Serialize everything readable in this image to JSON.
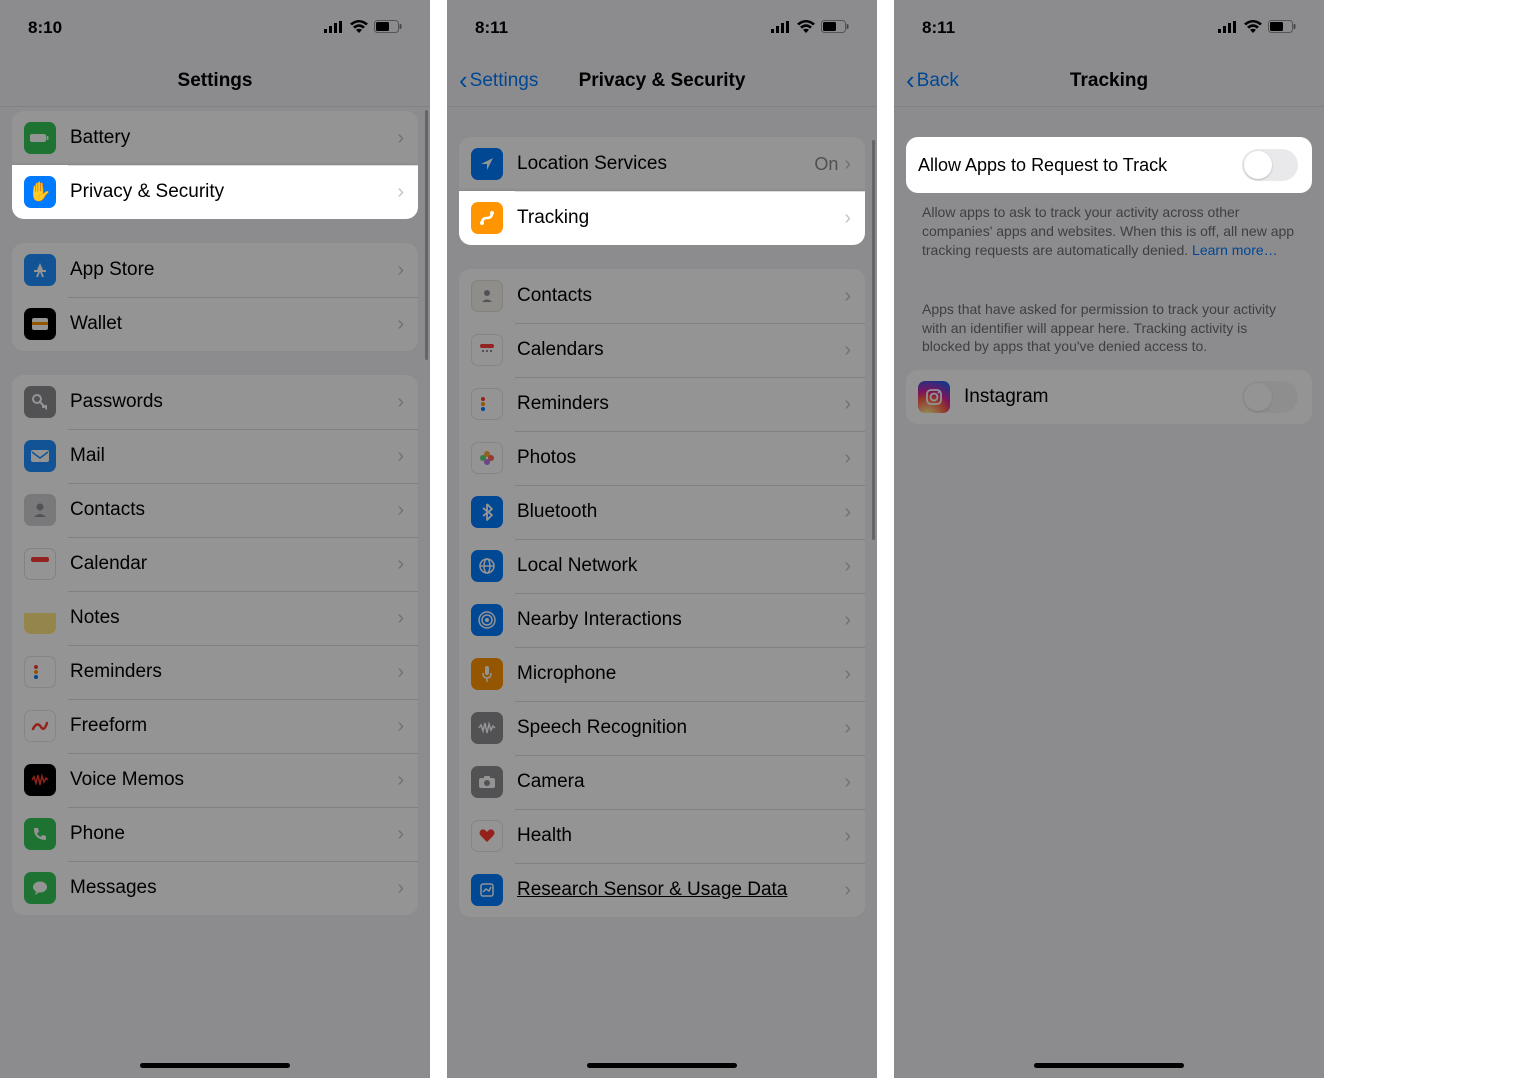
{
  "status": {
    "t1": "8:10",
    "t2": "8:11",
    "t3": "8:11"
  },
  "phone1": {
    "title": "Settings",
    "rows": {
      "battery": "Battery",
      "privacy": "Privacy & Security",
      "appstore": "App Store",
      "wallet": "Wallet",
      "passwords": "Passwords",
      "mail": "Mail",
      "contacts": "Contacts",
      "calendar": "Calendar",
      "notes": "Notes",
      "reminders": "Reminders",
      "freeform": "Freeform",
      "voicememos": "Voice Memos",
      "phone": "Phone",
      "messages": "Messages"
    }
  },
  "phone2": {
    "back": "Settings",
    "title": "Privacy & Security",
    "rows": {
      "location": "Location Services",
      "location_val": "On",
      "tracking": "Tracking",
      "contacts": "Contacts",
      "calendars": "Calendars",
      "reminders": "Reminders",
      "photos": "Photos",
      "bluetooth": "Bluetooth",
      "localnetwork": "Local Network",
      "nearby": "Nearby Interactions",
      "microphone": "Microphone",
      "speech": "Speech Recognition",
      "camera": "Camera",
      "health": "Health",
      "research": "Research Sensor & Usage Data"
    }
  },
  "phone3": {
    "back": "Back",
    "title": "Tracking",
    "allow_label": "Allow Apps to Request to Track",
    "note1_a": "Allow apps to ask to track your activity across other companies' apps and websites. When this is off, all new app tracking requests are automatically denied. ",
    "note1_link": "Learn more…",
    "note2": "Apps that have asked for permission to track your activity with an identifier will appear here. Tracking activity is blocked by apps that you've denied access to.",
    "instagram": "Instagram"
  }
}
